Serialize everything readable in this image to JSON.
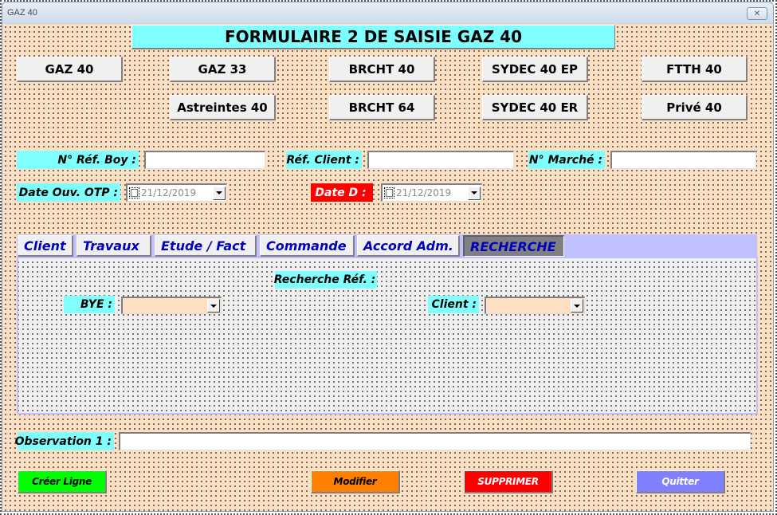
{
  "window": {
    "title": "GAZ 40",
    "close_icon": "close-icon"
  },
  "form": {
    "heading": "FORMULAIRE 2 DE SAISIE GAZ 40"
  },
  "nav_buttons": {
    "row1": [
      "GAZ 40",
      "GAZ 33",
      "BRCHT 40",
      "SYDEC 40 EP",
      "FTTH 40"
    ],
    "row2": [
      "Astreintes 40",
      "BRCHT 64",
      "SYDEC 40 ER",
      "Privé 40"
    ]
  },
  "fields": {
    "ref_boy": {
      "label": "N° Réf.  Boy :",
      "value": ""
    },
    "ref_client": {
      "label": "Réf. Client :",
      "value": ""
    },
    "marche": {
      "label": "N° Marché :",
      "value": ""
    },
    "date_ouv_otp": {
      "label": "Date Ouv. OTP :",
      "value": "21/12/2019",
      "checked": false
    },
    "date_d": {
      "label": "Date D :",
      "value": "21/12/2019",
      "checked": false
    }
  },
  "tabs": {
    "items": [
      {
        "label": "Client",
        "active": false
      },
      {
        "label": "Travaux",
        "active": false
      },
      {
        "label": "Etude / Fact",
        "active": false
      },
      {
        "label": "Commande",
        "active": false
      },
      {
        "label": "Accord Adm.",
        "active": false
      },
      {
        "label": "RECHERCHE",
        "active": true
      }
    ]
  },
  "recherche": {
    "heading": "Recherche Réf. :",
    "bye": {
      "label": "BYE :",
      "value": ""
    },
    "client": {
      "label": "Client :",
      "value": ""
    }
  },
  "observation": {
    "label": "Observation 1 :",
    "value": ""
  },
  "actions": {
    "create": {
      "label": "Créer Ligne",
      "color": "#00ff00",
      "text_color": "#000000"
    },
    "modify": {
      "label": "Modifier",
      "color": "#ff8000",
      "text_color": "#000000"
    },
    "delete": {
      "label": "SUPPRIMER",
      "color": "#ff0000",
      "text_color": "#ffffff"
    },
    "quit": {
      "label": "Quitter",
      "color": "#8080ff",
      "text_color": "#ffffff"
    }
  },
  "colors": {
    "form_background": "#fde0c4",
    "label_background": "#80ffff",
    "tab_text": "#0000c0",
    "tab_strip": "#c0c0ff"
  }
}
